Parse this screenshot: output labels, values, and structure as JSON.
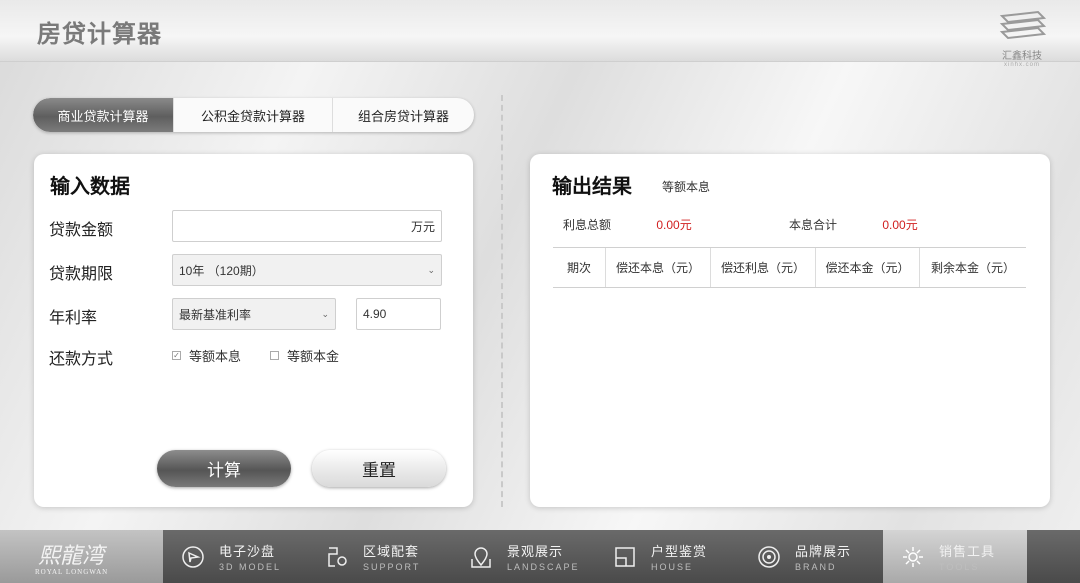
{
  "header": {
    "title": "房贷计算器",
    "brand_name": "汇鑫科技",
    "brand_domain": "xinhx.com"
  },
  "tabs": [
    {
      "label": "商业贷款计算器",
      "active": true
    },
    {
      "label": "公积金贷款计算器",
      "active": false
    },
    {
      "label": "组合房贷计算器",
      "active": false
    }
  ],
  "input_panel": {
    "title": "输入数据",
    "loan_amount": {
      "label": "贷款金额",
      "value": "",
      "unit": "万元"
    },
    "loan_term": {
      "label": "贷款期限",
      "selected": "10年 （120期）"
    },
    "rate": {
      "label": "年利率",
      "type_selected": "最新基准利率",
      "value": "4.90"
    },
    "repay_method": {
      "label": "还款方式",
      "options": [
        {
          "label": "等额本息",
          "checked": true
        },
        {
          "label": "等额本金",
          "checked": false
        }
      ]
    },
    "calc_button": "计算",
    "reset_button": "重置"
  },
  "output_panel": {
    "title": "输出结果",
    "method": "等额本息",
    "total_interest_label": "利息总额",
    "total_interest_value": "0.00元",
    "total_sum_label": "本息合计",
    "total_sum_value": "0.00元",
    "table_headers": [
      "期次",
      "偿还本息（元）",
      "偿还利息（元）",
      "偿还本金（元）",
      "剩余本金（元）"
    ]
  },
  "footer": {
    "logo_cn": "熙龍湾",
    "logo_en": "ROYAL LONGWAN",
    "nav": [
      {
        "cn": "电子沙盘",
        "en": "3D MODEL",
        "icon": "play-icon"
      },
      {
        "cn": "区域配套",
        "en": "SUPPORT",
        "icon": "location-route-icon"
      },
      {
        "cn": "景观展示",
        "en": "LANDSCAPE",
        "icon": "map-pin-icon"
      },
      {
        "cn": "户型鉴赏",
        "en": "HOUSE",
        "icon": "floorplan-icon"
      },
      {
        "cn": "品牌展示",
        "en": "BRAND",
        "icon": "broadcast-icon"
      },
      {
        "cn": "销售工具",
        "en": "TOOLS",
        "icon": "gear-icon",
        "active": true
      }
    ]
  },
  "colors": {
    "accent_red": "#d12020",
    "tab_active": "#6a6a6a"
  }
}
